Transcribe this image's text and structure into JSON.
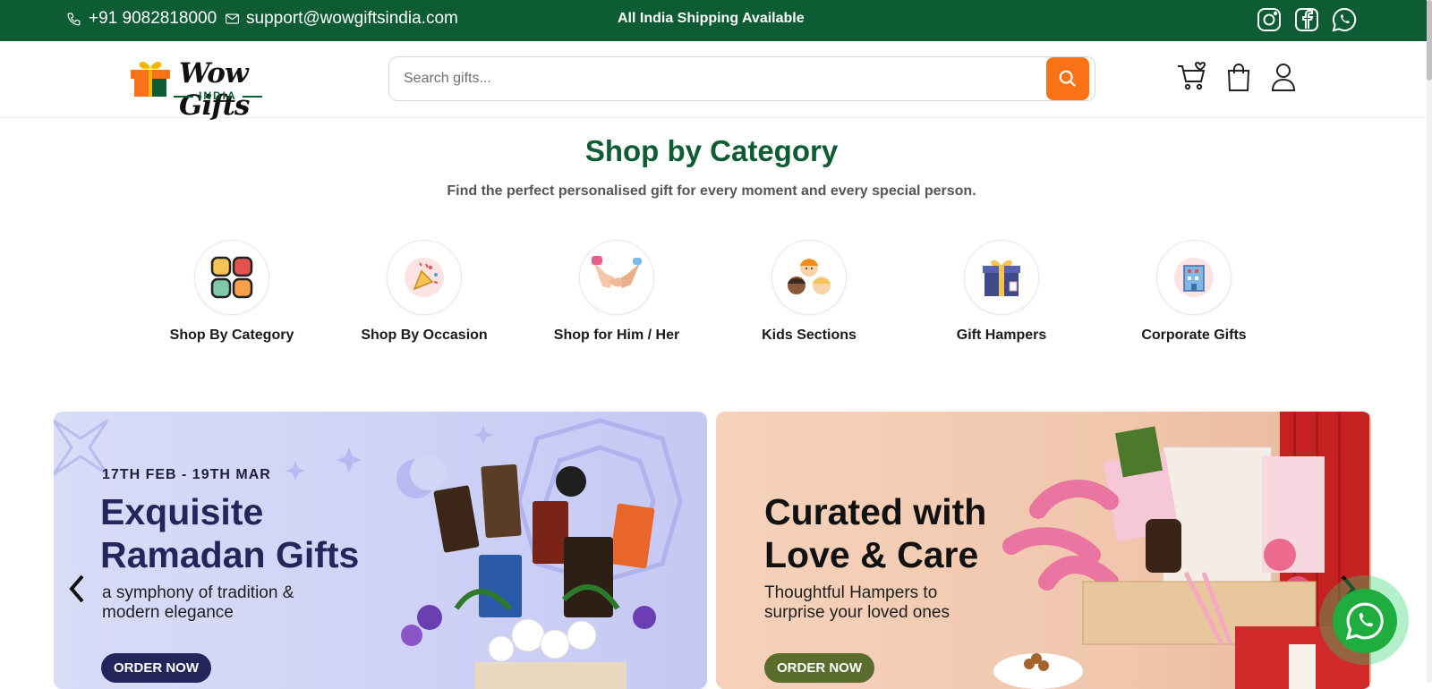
{
  "topbar": {
    "phone": "+91 9082818000",
    "email": "support@wowgiftsindia.com",
    "shipping": "All India Shipping Available",
    "social": [
      "instagram-icon",
      "facebook-icon",
      "whatsapp-icon"
    ]
  },
  "header": {
    "logo_text": "Wow Gifts",
    "logo_sub": "INDIA",
    "search_placeholder": "Search gifts...",
    "icons": [
      "wishlist-cart-icon",
      "shopping-bag-icon",
      "user-icon"
    ]
  },
  "section": {
    "title": "Shop by Category",
    "subtitle": "Find the perfect personalised gift for every moment and every special person."
  },
  "categories": [
    {
      "label": "Shop By Category",
      "icon": "grid-icon"
    },
    {
      "label": "Shop By Occasion",
      "icon": "party-popper-icon"
    },
    {
      "label": "Shop for Him / Her",
      "icon": "handshake-icon"
    },
    {
      "label": "Kids Sections",
      "icon": "kids-icon"
    },
    {
      "label": "Gift Hampers",
      "icon": "gift-box-icon"
    },
    {
      "label": "Corporate Gifts",
      "icon": "office-building-icon"
    }
  ],
  "banners": [
    {
      "date": "17TH FEB - 19TH MAR",
      "heading": "Exquisite Ramadan Gifts",
      "text": "a symphony of tradition & modern elegance",
      "button": "ORDER NOW"
    },
    {
      "heading": "Curated with Love & Care",
      "text": "Thoughtful Hampers to surprise your loved ones",
      "button": "ORDER NOW"
    }
  ],
  "colors": {
    "brand_green": "#0d5c34",
    "accent_orange": "#f97316",
    "whatsapp_green": "#1fad3f"
  }
}
